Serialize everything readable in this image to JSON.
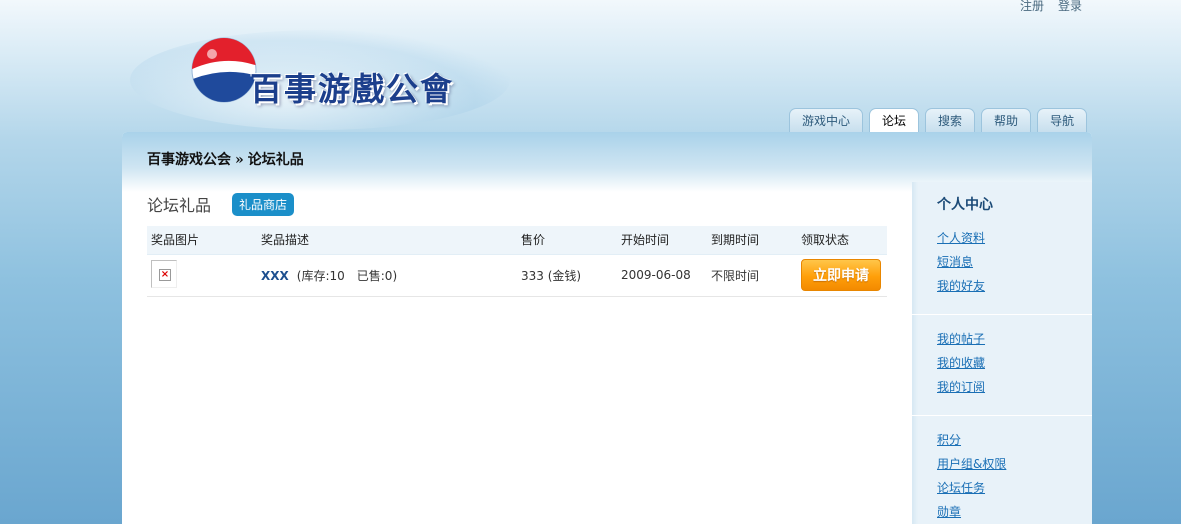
{
  "top_links": [
    {
      "name": "register-link",
      "label": "注册"
    },
    {
      "name": "login-link",
      "label": "登录"
    }
  ],
  "logo": {
    "text": "百事游戲公會",
    "icon": "pepsi-globe-icon"
  },
  "nav_tabs": [
    {
      "name": "tab-game-center",
      "label": "游戏中心",
      "active": false
    },
    {
      "name": "tab-forum",
      "label": "论坛",
      "active": true
    },
    {
      "name": "tab-search",
      "label": "搜索",
      "active": false
    },
    {
      "name": "tab-help",
      "label": "帮助",
      "active": false
    },
    {
      "name": "tab-navigation",
      "label": "导航",
      "active": false
    }
  ],
  "breadcrumb": {
    "home": "百事游戏公会",
    "separator": "»",
    "current": "论坛礼品"
  },
  "content": {
    "title": "论坛礼品",
    "shop_button": "礼品商店"
  },
  "table": {
    "headers": [
      "奖品图片",
      "奖品描述",
      "售价",
      "开始时间",
      "到期时间",
      "领取状态"
    ],
    "rows": [
      {
        "name": "XXX",
        "stock_info": "(库存:10　已售:0)",
        "price": "333 (金钱)",
        "start": "2009-06-08",
        "expire": "不限时间",
        "action": "立即申请"
      }
    ]
  },
  "sidebar": {
    "title": "个人中心",
    "sections": [
      [
        "个人资料",
        "短消息",
        "我的好友"
      ],
      [
        "我的帖子",
        "我的收藏",
        "我的订阅"
      ],
      [
        "积分",
        "用户组&权限",
        "论坛任务",
        "勋章"
      ]
    ]
  },
  "colors": {
    "accent": "#1b8fc9",
    "button_orange": "#ff9f0a",
    "link": "#1a6fb5"
  }
}
